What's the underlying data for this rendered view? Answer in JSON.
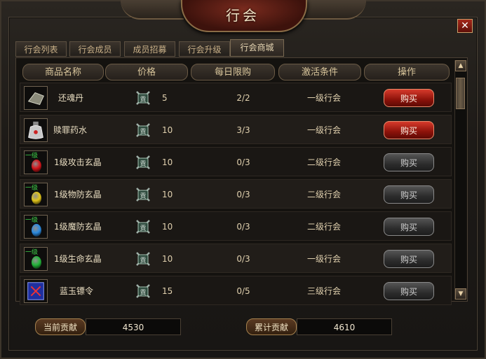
{
  "window": {
    "title": "行会",
    "close_icon": "close-icon"
  },
  "tabs": [
    {
      "label": "行会列表",
      "active": false
    },
    {
      "label": "行会成员",
      "active": false
    },
    {
      "label": "成员招募",
      "active": false
    },
    {
      "label": "行会升级",
      "active": false
    },
    {
      "label": "行会商城",
      "active": true
    }
  ],
  "columns": [
    "商品名称",
    "价格",
    "每日限购",
    "激活条件",
    "操作"
  ],
  "items": [
    {
      "icon": "stone-icon",
      "level_tag": "",
      "name": "还魂丹",
      "price_icon": "contribution-icon",
      "price": "5",
      "limit": "2/2",
      "condition": "一级行会",
      "buy": "购买",
      "enabled": true
    },
    {
      "icon": "potion-bottle-icon",
      "level_tag": "",
      "name": "赎罪药水",
      "price_icon": "contribution-icon",
      "price": "10",
      "limit": "3/3",
      "condition": "一级行会",
      "buy": "购买",
      "enabled": true
    },
    {
      "icon": "red-gem-icon",
      "level_tag": "一级",
      "name": "1级攻击玄晶",
      "price_icon": "contribution-icon",
      "price": "10",
      "limit": "0/3",
      "condition": "二级行会",
      "buy": "购买",
      "enabled": false,
      "gem_color": "#d4141a"
    },
    {
      "icon": "yellow-gem-icon",
      "level_tag": "一级",
      "name": "1级物防玄晶",
      "price_icon": "contribution-icon",
      "price": "10",
      "limit": "0/3",
      "condition": "二级行会",
      "buy": "购买",
      "enabled": false,
      "gem_color": "#e0c41a"
    },
    {
      "icon": "blue-gem-icon",
      "level_tag": "一级",
      "name": "1级魔防玄晶",
      "price_icon": "contribution-icon",
      "price": "10",
      "limit": "0/3",
      "condition": "二级行会",
      "buy": "购买",
      "enabled": false,
      "gem_color": "#2a8ae0"
    },
    {
      "icon": "green-gem-icon",
      "level_tag": "一级",
      "name": "1级生命玄晶",
      "price_icon": "contribution-icon",
      "price": "10",
      "limit": "0/3",
      "condition": "一级行会",
      "buy": "购买",
      "enabled": false,
      "gem_color": "#23b43a"
    },
    {
      "icon": "token-icon",
      "level_tag": "",
      "name": "蓝玉镖令",
      "price_icon": "contribution-icon",
      "price": "15",
      "limit": "0/5",
      "condition": "三级行会",
      "buy": "购买",
      "enabled": false
    }
  ],
  "footer": {
    "current_label": "当前贡献",
    "current_value": "4530",
    "total_label": "累计贡献",
    "total_value": "4610"
  }
}
